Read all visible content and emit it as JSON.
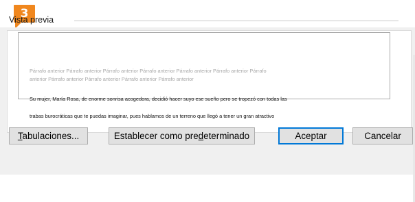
{
  "step_badge": "3",
  "preview": {
    "title": "Vista previa",
    "previous_paragraph_line1": "Párrafo anterior Párrafo anterior Párrafo anterior Párrafo anterior Párrafo anterior Párrafo anterior Párrafo",
    "previous_paragraph_line2": "anterior Párrafo anterior Párrafo anterior Párrafo anterior Párrafo anterior",
    "current_paragraph_line1": "Su mujer, María Rosa, de enorme sonrisa acogedora, decidió hacer suyo ese sueño pero se tropezó con todas las",
    "current_paragraph_line2": "trabas burocráticas que te puedas imaginar, pues hablamos de un terreno que llegó a tener un gran atractivo"
  },
  "buttons": {
    "tabs": {
      "pre": "",
      "key": "T",
      "post": "abulaciones..."
    },
    "set_default": {
      "pre": "Establecer como pre",
      "key": "d",
      "post": "eterminado"
    },
    "accept": "Aceptar",
    "cancel": "Cancelar"
  },
  "colors": {
    "badge": "#f0871e",
    "dialog_bg": "#f0f0f0",
    "default_button_border": "#0078d7"
  }
}
